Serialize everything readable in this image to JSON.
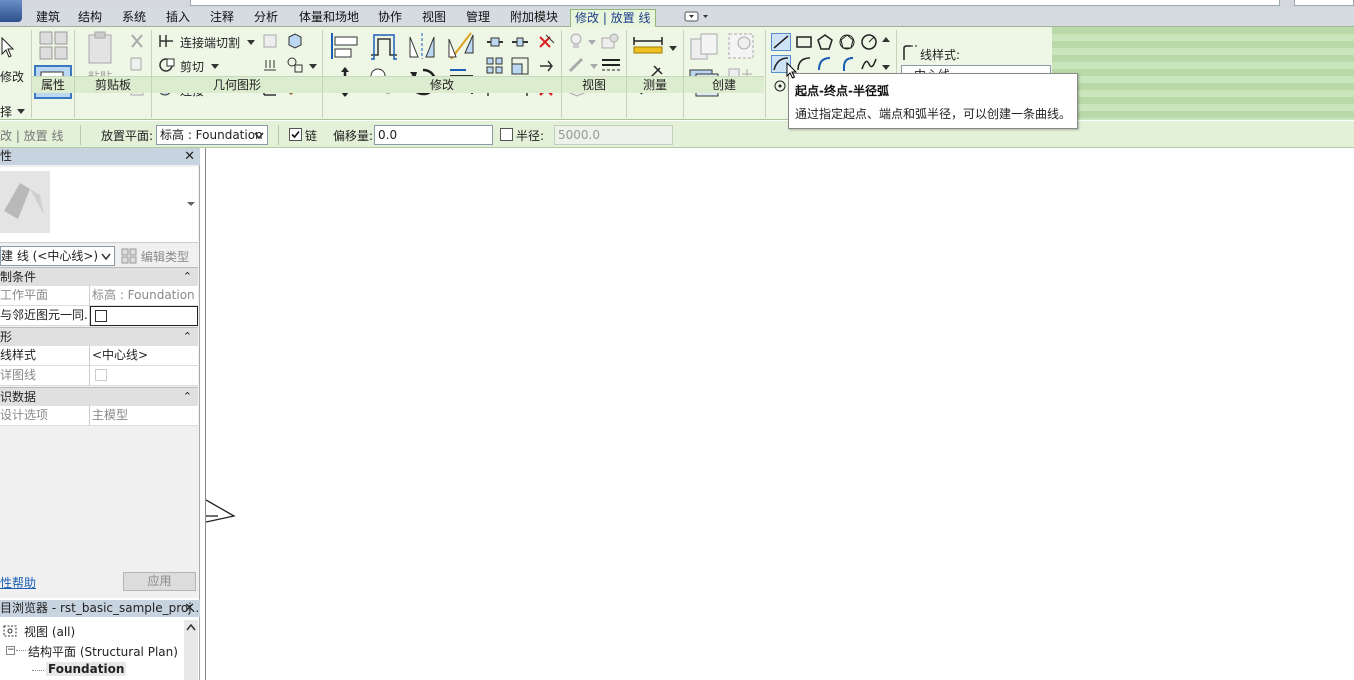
{
  "tabs": [
    "建筑",
    "结构",
    "系统",
    "插入",
    "注释",
    "分析",
    "体量和场地",
    "协作",
    "视图",
    "管理",
    "附加模块",
    "修改 | 放置 线"
  ],
  "ribbon": {
    "select_label": "择",
    "modify_label": "修改",
    "panels": {
      "properties": "属性",
      "clipboard": "剪贴板",
      "geometry": "几何图形",
      "modify": "修改",
      "view": "视图",
      "measure": "测量",
      "create": "创建"
    },
    "paste_label": "粘贴",
    "geometry_buttons": [
      "连接端切割",
      "剪切",
      "连接"
    ],
    "line_style_label": "线样式:",
    "line_style_value": "中心线"
  },
  "options_bar": {
    "context_label": "改 | 放置 线",
    "placement_plane_label": "放置平面:",
    "placement_plane_value": "标高 : Foundation",
    "chain_label": "链",
    "chain_checked": true,
    "offset_label": "偏移量:",
    "offset_value": "0.0",
    "radius_label": "半径:",
    "radius_checked": false,
    "radius_value": "5000.0"
  },
  "properties": {
    "title": "性",
    "type_selector": "建 线 (<中心线>)",
    "edit_type": "编辑类型",
    "groups": [
      {
        "name": "制条件",
        "rows": [
          {
            "key": "工作平面",
            "value": "标高 : Foundation",
            "dim": true
          },
          {
            "key": "与邻近图元一同...",
            "value": "",
            "checkbox": true,
            "dim": false
          }
        ]
      },
      {
        "name": "形",
        "rows": [
          {
            "key": "线样式",
            "value": "<中心线>",
            "dim": false
          },
          {
            "key": "详图线",
            "value": "",
            "checkbox": true,
            "dim": true
          }
        ]
      },
      {
        "name": "识数据",
        "rows": [
          {
            "key": "设计选项",
            "value": "主模型",
            "dim": true
          }
        ]
      }
    ],
    "help_link": "性帮助",
    "apply_button": "应用"
  },
  "browser": {
    "title": "目浏览器 - rst_basic_sample_proj...",
    "items": [
      "视图 (all)",
      "结构平面 (Structural Plan)",
      "Foundation"
    ]
  },
  "tooltip": {
    "title": "起点-终点-半径弧",
    "description": "通过指定起点、端点和弧半径，可以创建一条曲线。"
  },
  "colors": {
    "ribbon_bg": "#eef7e6",
    "tab_active_text": "#1f3d8a",
    "title_bar": "#c8d3e0",
    "link": "#1a5fb4"
  }
}
